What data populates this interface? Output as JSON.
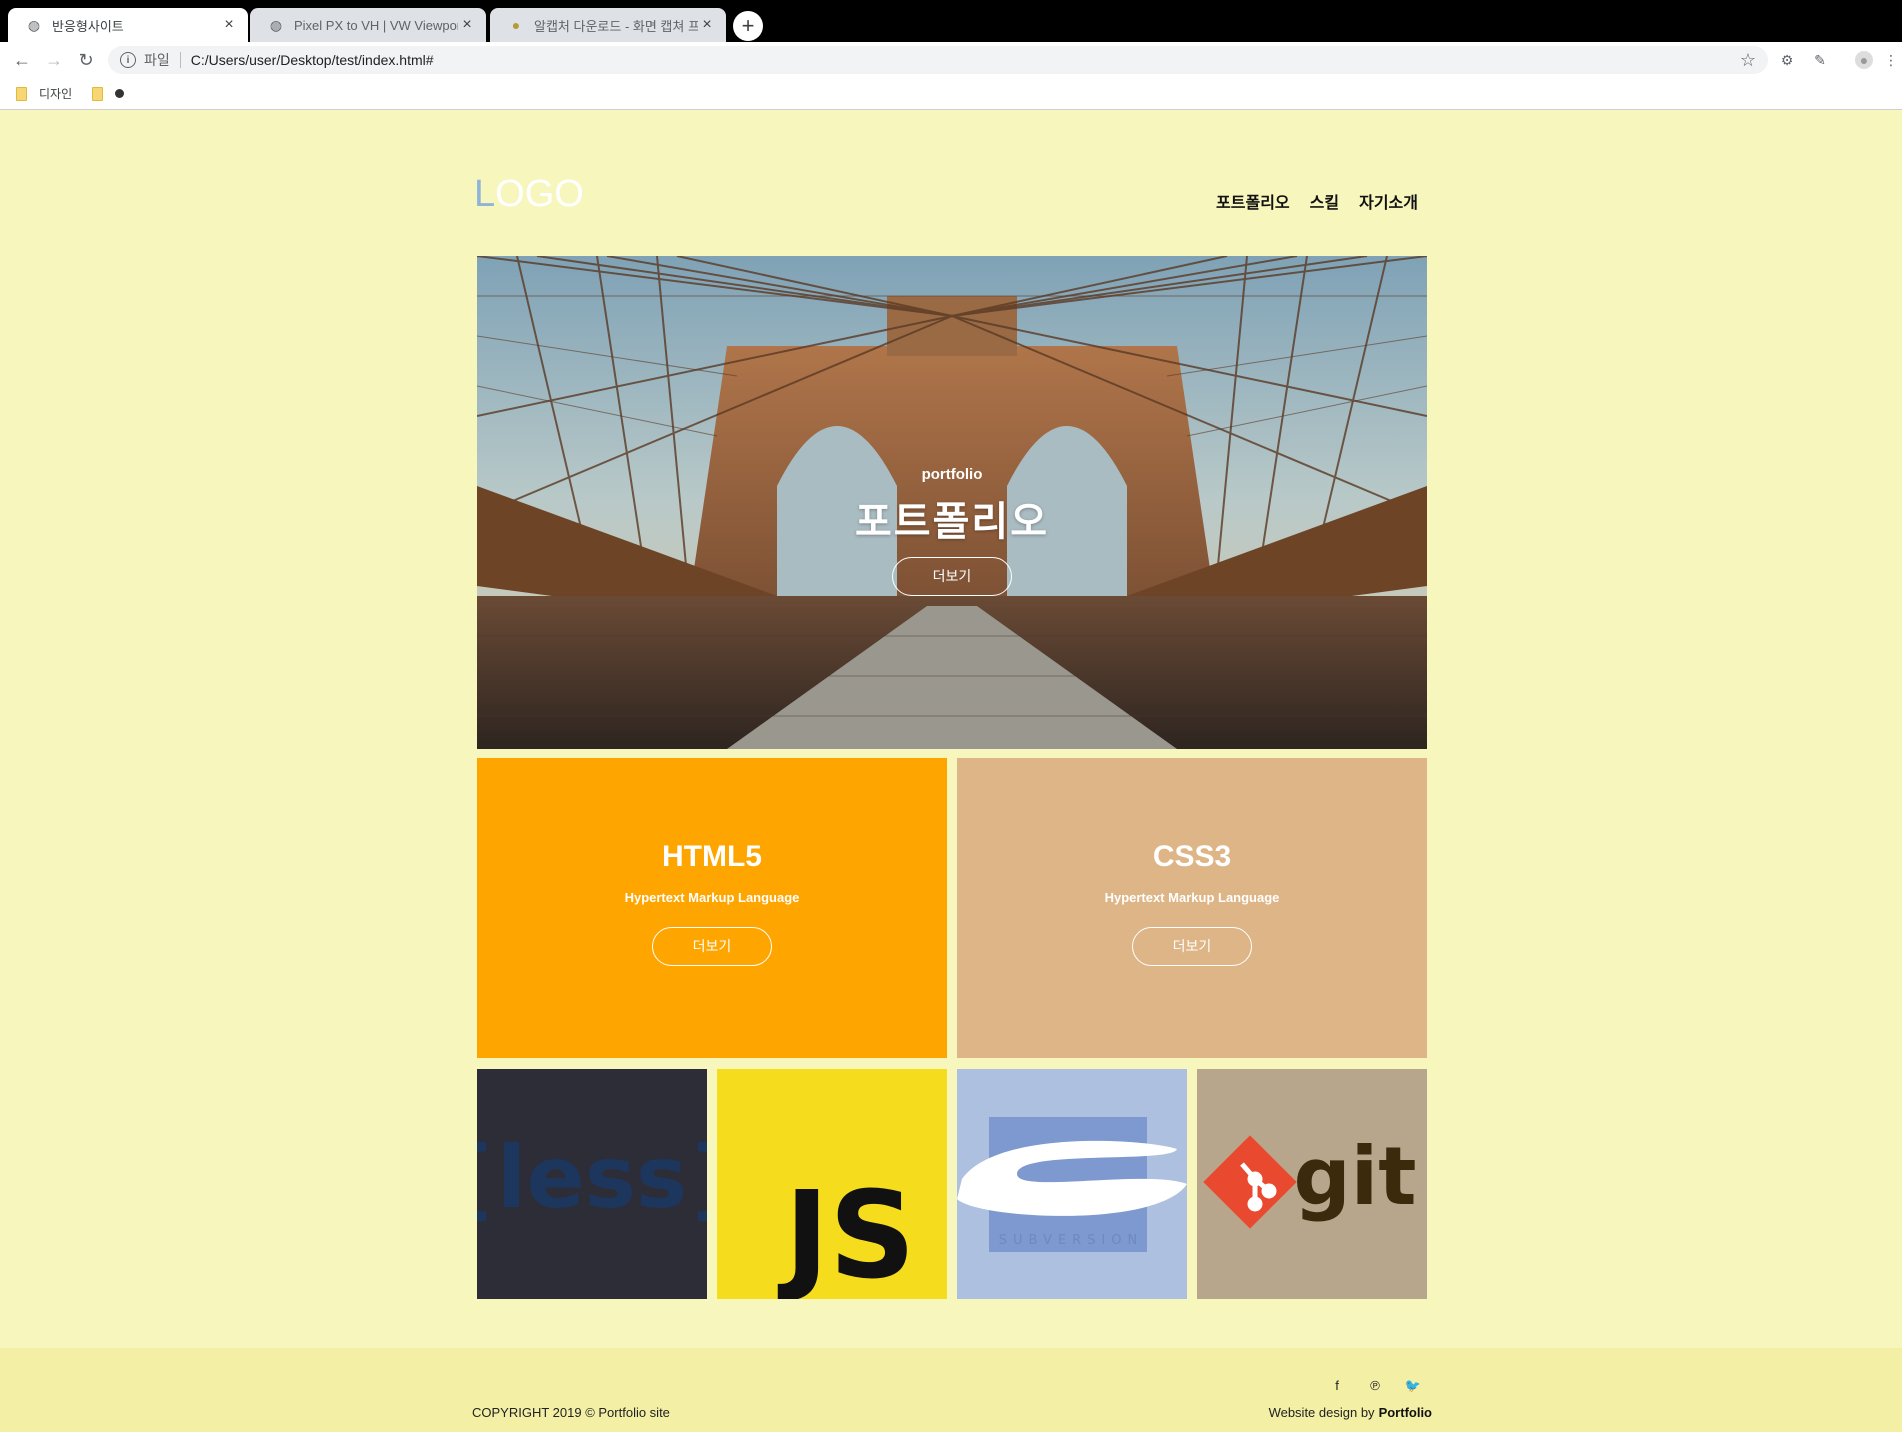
{
  "browser": {
    "tabs": [
      {
        "title": "반응형사이트",
        "favicon": "globe-icon",
        "active": true
      },
      {
        "title": "Pixel PX to VH | VW Viewport c",
        "favicon": "globe-icon",
        "active": false
      },
      {
        "title": "알캡처 다운로드 - 화면 캡쳐 프",
        "favicon": "alcapture-icon",
        "active": false
      }
    ],
    "new_tab": "+",
    "address": {
      "scheme": "파일",
      "url": "C:/Users/user/Desktop/test/index.html#"
    },
    "bookmarks": [
      {
        "label": "디자인",
        "icon": "folder-icon"
      },
      {
        "label": "",
        "icon": "folder-icon"
      }
    ]
  },
  "site": {
    "logo": {
      "first": "L",
      "rest": "OGO"
    },
    "nav": [
      "포트폴리오",
      "스킬",
      "자기소개"
    ],
    "hero": {
      "sub": "portfolio",
      "title": "포트폴리오",
      "button": "더보기"
    },
    "cards": [
      {
        "title": "HTML5",
        "desc": "Hypertext Markup Language",
        "button": "더보기",
        "color": "#fea500"
      },
      {
        "title": "CSS3",
        "desc": "Hypertext Markup Language",
        "button": "더보기",
        "color": "#ddb586"
      }
    ],
    "tiles": [
      {
        "label": "{less}",
        "icon": "less-logo",
        "bg": "#2d2d37"
      },
      {
        "label": "JS",
        "icon": "javascript-logo",
        "bg": "#f5dc1d"
      },
      {
        "label": "SUBVERSION",
        "icon": "subversion-logo",
        "bg": "#adc0e0"
      },
      {
        "label": "git",
        "icon": "git-logo",
        "bg": "#b8a68c"
      }
    ],
    "footer": {
      "copyright": "COPYRIGHT 2019 © Portfolio site",
      "credit_prefix": "Website design by",
      "credit_name": "Portfolio",
      "social": [
        "f",
        "℗",
        "🐦"
      ]
    }
  }
}
